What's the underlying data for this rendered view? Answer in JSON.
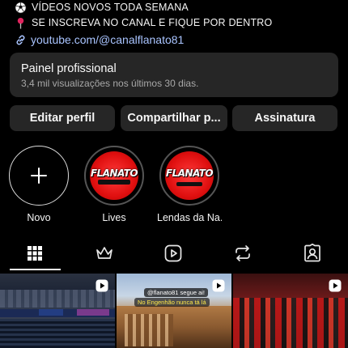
{
  "bio": {
    "line1": "VÍDEOS NOVOS TODA SEMANA",
    "line2": "SE INSCREVA NO CANAL E FIQUE POR DENTRO",
    "link": "youtube.com/@canalflanato81",
    "icons": [
      "soccer-ball-icon",
      "pin-icon",
      "link-icon"
    ]
  },
  "professional_panel": {
    "title": "Painel profissional",
    "subtitle": "3,4 mil visualizações nos últimos 30 dias."
  },
  "buttons": {
    "edit": "Editar perfil",
    "share": "Compartilhar p...",
    "subscription": "Assinatura"
  },
  "highlights": [
    {
      "label": "Novo",
      "logo": ""
    },
    {
      "label": "Lives",
      "logo": "FLANATO"
    },
    {
      "label": "Lendas da Na...",
      "logo": "FLANATO"
    }
  ],
  "tabs": [
    "grid-icon",
    "crown-icon",
    "reels-icon",
    "reposts-icon",
    "tagged-icon"
  ],
  "posts": [
    {
      "caption": "",
      "type": "reel"
    },
    {
      "caption_top": "@flanato81 segue ai!",
      "caption_mid": "No Engenhão nunca tá lá",
      "type": "reel"
    },
    {
      "caption": "",
      "type": "reel"
    }
  ],
  "colors": {
    "background": "#000000",
    "surface": "#262626",
    "link": "#a9c4ff",
    "highlight_red": "#e01010"
  }
}
